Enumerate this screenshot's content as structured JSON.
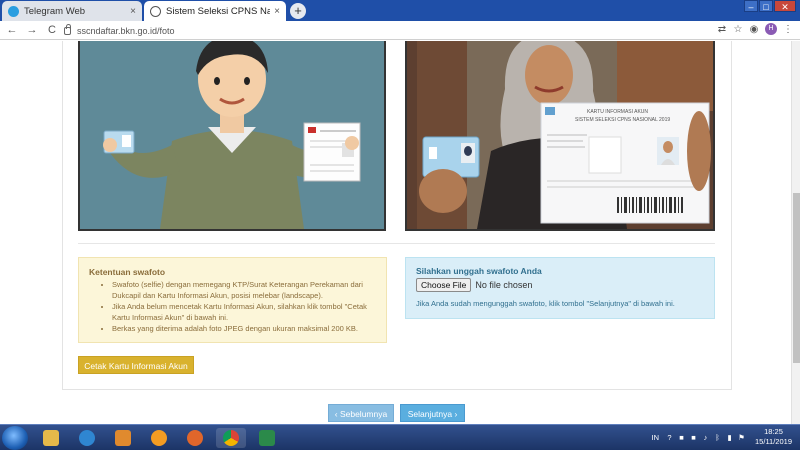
{
  "browser": {
    "tabs": [
      {
        "label": "Telegram Web",
        "close": "×"
      },
      {
        "label": "Sistem Seleksi CPNS Nasional",
        "close": "×"
      }
    ],
    "new_tab": "+",
    "window_controls": {
      "minimize": "–",
      "maximize": "□",
      "close": "✕"
    },
    "nav": {
      "back": "←",
      "forward": "→",
      "reload": "C"
    },
    "url": "sscndaftar.bkn.go.id/foto",
    "profile_initial": "H",
    "menu": "⋮"
  },
  "illustration": {
    "card_header": "KARTU INFORMASI AKUN",
    "card_subheader": "SISTEM SELEKSI CPNS NASIONAL 2019"
  },
  "rules": {
    "title": "Ketentuan swafoto",
    "items": [
      "Swafoto (selfie) dengan memegang KTP/Surat Keterangan Perekaman dari Dukcapil dan Kartu Informasi Akun, posisi melebar (landscape).",
      "Jika Anda belum mencetak Kartu Informasi Akun, silahkan klik tombol \"Cetak Kartu Informasi Akun\" di bawah ini.",
      "Berkas yang diterima adalah foto JPEG dengan ukuran maksimal 200 KB."
    ]
  },
  "upload": {
    "title": "Silahkan unggah swafoto Anda",
    "choose_label": "Choose File",
    "no_file": "No file chosen",
    "hint": "Jika Anda sudah mengunggah swafoto, klik tombol \"Selanjutnya\" di bawah ini."
  },
  "buttons": {
    "print_card": "Cetak Kartu Informasi Akun",
    "previous": "‹ Sebelumnya",
    "next": "Selanjutnya ›"
  },
  "taskbar": {
    "lang": "IN",
    "time": "18:25",
    "date": "15/11/2019"
  },
  "colors": {
    "warning_bg": "#fcf6d9",
    "info_bg": "#daeef8",
    "print_button": "#d9b22e",
    "nav_button": "#5aaedf"
  }
}
